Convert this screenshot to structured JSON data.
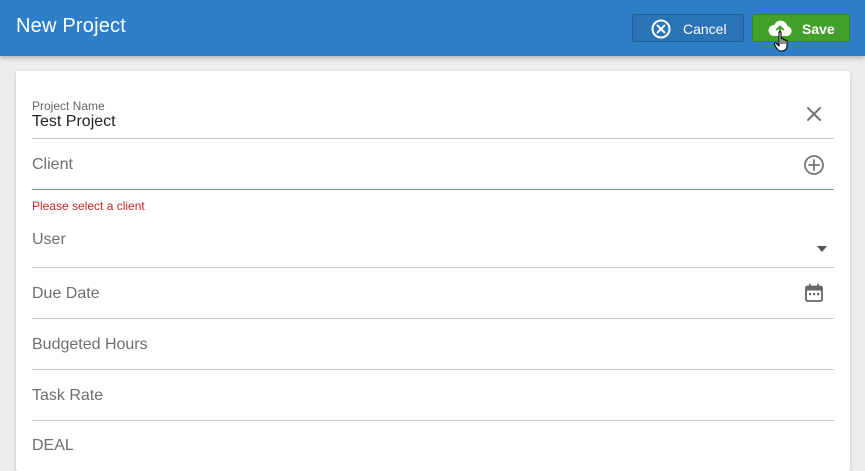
{
  "header": {
    "title": "New Project",
    "cancel_label": "Cancel",
    "save_label": "Save"
  },
  "form": {
    "project_name": {
      "label": "Project Name",
      "value": "Test Project"
    },
    "client": {
      "placeholder": "Client",
      "error": "Please select a client"
    },
    "user": {
      "placeholder": "User"
    },
    "due_date": {
      "placeholder": "Due Date"
    },
    "budgeted_hours": {
      "placeholder": "Budgeted Hours"
    },
    "task_rate": {
      "placeholder": "Task Rate"
    },
    "next_field": {
      "placeholder": "DEAL"
    }
  },
  "colors": {
    "header_bg": "#2f7fc8",
    "save_green": "#43a02a",
    "error_red": "#c62828"
  },
  "icons": [
    "close-circle-icon",
    "cloud-upload-icon",
    "clear-icon",
    "add-circle-icon",
    "dropdown-arrow-icon",
    "calendar-icon",
    "hand-cursor-icon"
  ]
}
